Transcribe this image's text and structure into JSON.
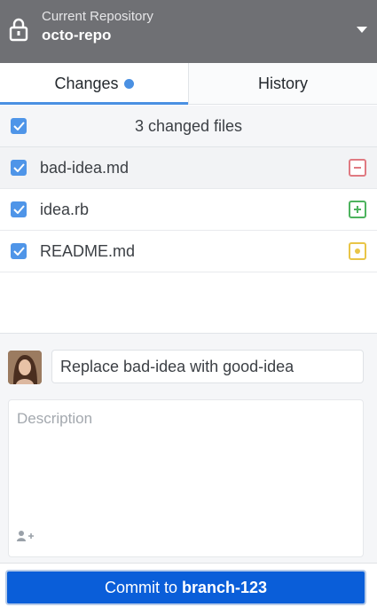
{
  "repo": {
    "caption": "Current Repository",
    "name": "octo-repo",
    "lock_icon": "lock-icon",
    "caret_icon": "caret-down-icon"
  },
  "tabs": [
    {
      "label": "Changes",
      "active": true,
      "has_indicator": true
    },
    {
      "label": "History",
      "active": false
    }
  ],
  "changes": {
    "summary": "3 changed files",
    "all_checked": true,
    "files": [
      {
        "name": "bad-idea.md",
        "checked": true,
        "status": "removed",
        "status_icon": "minus-icon"
      },
      {
        "name": "idea.rb",
        "checked": true,
        "status": "added",
        "status_icon": "plus-icon"
      },
      {
        "name": "README.md",
        "checked": true,
        "status": "modified",
        "status_icon": "dot-icon"
      }
    ]
  },
  "commit": {
    "summary_value": "Replace bad-idea with good-idea",
    "description_placeholder": "Description",
    "button_prefix": "Commit to",
    "branch": "branch-123"
  },
  "colors": {
    "header_bg": "#6f7074",
    "accent": "#4a90e2",
    "commit_button": "#0a5ed9",
    "removed": "#e07a82",
    "added": "#4db35e",
    "modified": "#e9c547"
  }
}
